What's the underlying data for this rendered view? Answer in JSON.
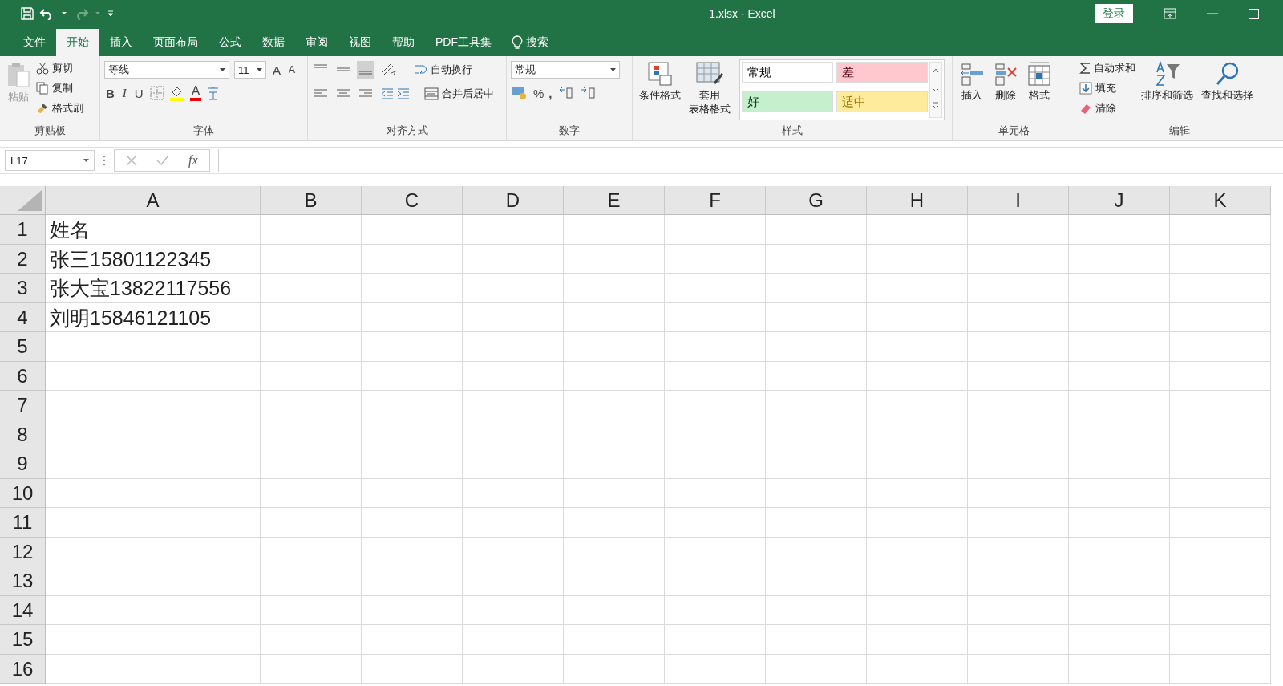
{
  "window": {
    "title": "1.xlsx  -  Excel",
    "account_button": "登录"
  },
  "tabs": [
    {
      "label": "文件",
      "selected": false
    },
    {
      "label": "开始",
      "selected": true
    },
    {
      "label": "插入",
      "selected": false
    },
    {
      "label": "页面布局",
      "selected": false
    },
    {
      "label": "公式",
      "selected": false
    },
    {
      "label": "数据",
      "selected": false
    },
    {
      "label": "审阅",
      "selected": false
    },
    {
      "label": "视图",
      "selected": false
    },
    {
      "label": "帮助",
      "selected": false
    },
    {
      "label": "PDF工具集",
      "selected": false
    }
  ],
  "search": {
    "label": "搜索"
  },
  "ribbon": {
    "clipboard": {
      "title": "剪贴板",
      "paste": "粘贴",
      "cut": "剪切",
      "copy": "复制",
      "format_painter": "格式刷"
    },
    "font": {
      "title": "字体",
      "font_name": "等线",
      "font_size": "11",
      "grow": "A",
      "shrink": "A",
      "bold": "B",
      "italic": "I",
      "underline": "U",
      "font_color": "A"
    },
    "alignment": {
      "title": "对齐方式",
      "wrap": "自动换行",
      "merge": "合并后居中"
    },
    "number": {
      "title": "数字",
      "format": "常规",
      "percent": "%",
      "comma": ","
    },
    "styles": {
      "title": "样式",
      "conditional": "条件格式",
      "table_format": [
        "套用",
        "表格格式"
      ],
      "gallery": [
        {
          "label": "常规",
          "color": "#ffffff"
        },
        {
          "label": "差",
          "color": "#ffc7ce"
        },
        {
          "label": "好",
          "color": "#c6efce"
        },
        {
          "label": "适中",
          "color": "#ffeb9c"
        }
      ]
    },
    "cells": {
      "title": "单元格",
      "insert": "插入",
      "delete": "删除",
      "format": "格式"
    },
    "editing": {
      "title": "编辑",
      "autosum": "自动求和",
      "fill": "填充",
      "clear": "清除",
      "sort": "排序和筛选",
      "find": "查找和选择"
    }
  },
  "formula_bar": {
    "name_box": "L17",
    "function_label": "fx"
  },
  "grid": {
    "columns": [
      "A",
      "B",
      "C",
      "D",
      "E",
      "F",
      "G",
      "H",
      "I",
      "J",
      "K"
    ],
    "rows": [
      {
        "number": "1",
        "cells": [
          "姓名"
        ]
      },
      {
        "number": "2",
        "cells": [
          "张三15801122345"
        ]
      },
      {
        "number": "3",
        "cells": [
          "张大宝13822117556"
        ]
      },
      {
        "number": "4",
        "cells": [
          "刘明15846121105"
        ]
      },
      {
        "number": "5",
        "cells": []
      },
      {
        "number": "6",
        "cells": []
      },
      {
        "number": "7",
        "cells": []
      },
      {
        "number": "8",
        "cells": []
      },
      {
        "number": "9",
        "cells": []
      },
      {
        "number": "10",
        "cells": []
      },
      {
        "number": "11",
        "cells": []
      },
      {
        "number": "12",
        "cells": []
      },
      {
        "number": "13",
        "cells": []
      },
      {
        "number": "14",
        "cells": []
      },
      {
        "number": "15",
        "cells": []
      },
      {
        "number": "16",
        "cells": []
      }
    ]
  }
}
